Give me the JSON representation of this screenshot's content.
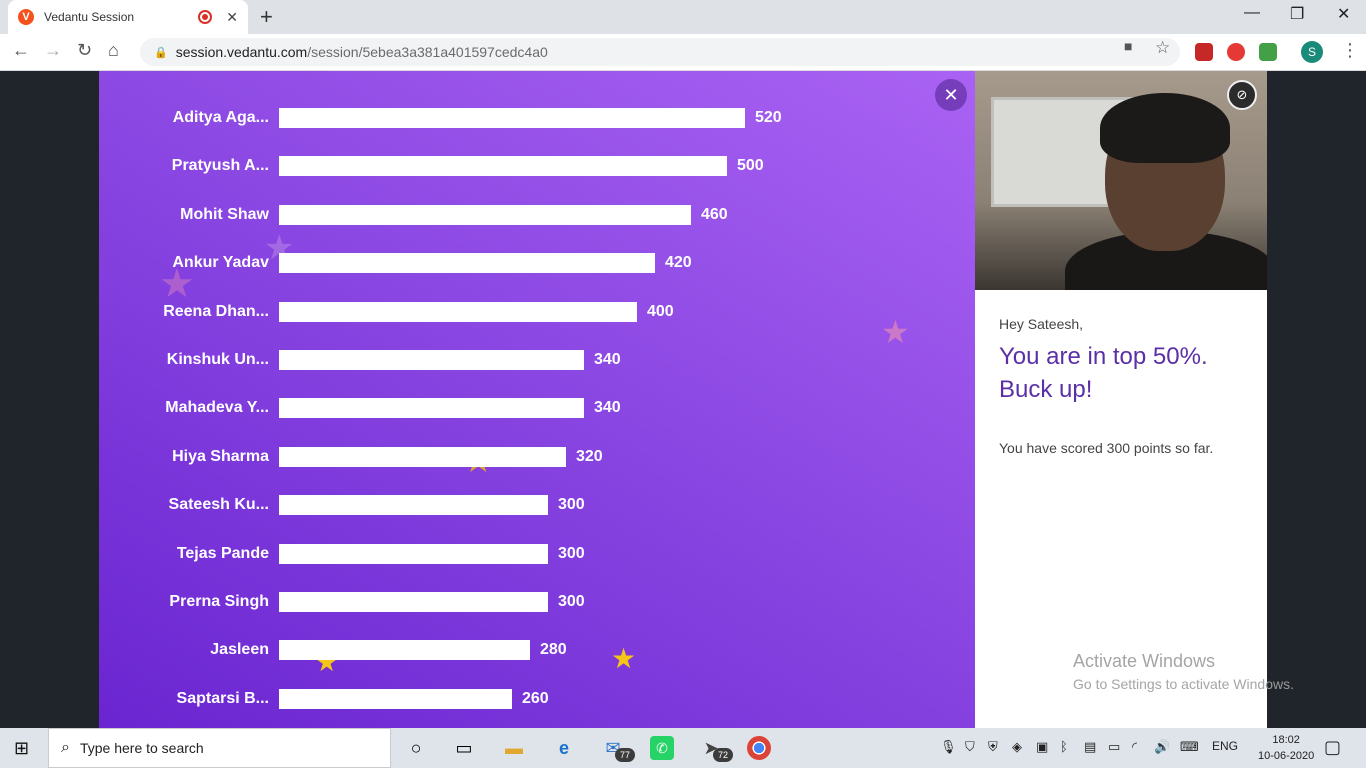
{
  "browser": {
    "tab_title": "Vedantu Session",
    "tab_favicon_letter": "V",
    "url_host": "session.vedantu.com",
    "url_path": "/session/5ebea3a381a401597cedc4a0",
    "profile_letter": "S",
    "new_tab_symbol": "+",
    "close_symbol": "✕",
    "minimize_symbol": "—",
    "restore_symbol": "❐"
  },
  "leaderboard": {
    "close_symbol": "✕",
    "max_score": 520,
    "rows": [
      {
        "name": "Aditya Aga...",
        "score": 520
      },
      {
        "name": "Pratyush A...",
        "score": 500
      },
      {
        "name": "Mohit Shaw",
        "score": 460
      },
      {
        "name": "Ankur Yadav",
        "score": 420
      },
      {
        "name": "Reena Dhan...",
        "score": 400
      },
      {
        "name": "Kinshuk Un...",
        "score": 340
      },
      {
        "name": "Mahadeva Y...",
        "score": 340
      },
      {
        "name": "Hiya Sharma",
        "score": 320
      },
      {
        "name": "Sateesh Ku...",
        "score": 300
      },
      {
        "name": "Tejas Pande",
        "score": 300
      },
      {
        "name": "Prerna Singh",
        "score": 300
      },
      {
        "name": "Jasleen",
        "score": 280
      },
      {
        "name": "Saptarsi B...",
        "score": 260
      }
    ]
  },
  "panel": {
    "greeting": "Hey Sateesh,",
    "headline_line1": "You are in top 50%.",
    "headline_line2": "Buck up!",
    "score_text": "You have scored 300 points so far."
  },
  "watermark": {
    "title": "Activate Windows",
    "subtitle": "Go to Settings to activate Windows."
  },
  "taskbar": {
    "search_placeholder": "Type here to search",
    "mail_badge": "77",
    "telegram_badge": "72",
    "language": "ENG",
    "time": "18:02",
    "date": "10-06-2020"
  },
  "colors": {
    "leaderboard_top": "#a962f3",
    "leaderboard_bottom": "#6a25d1",
    "headline": "#5b2fa6",
    "star_gold": "#f5c518"
  }
}
